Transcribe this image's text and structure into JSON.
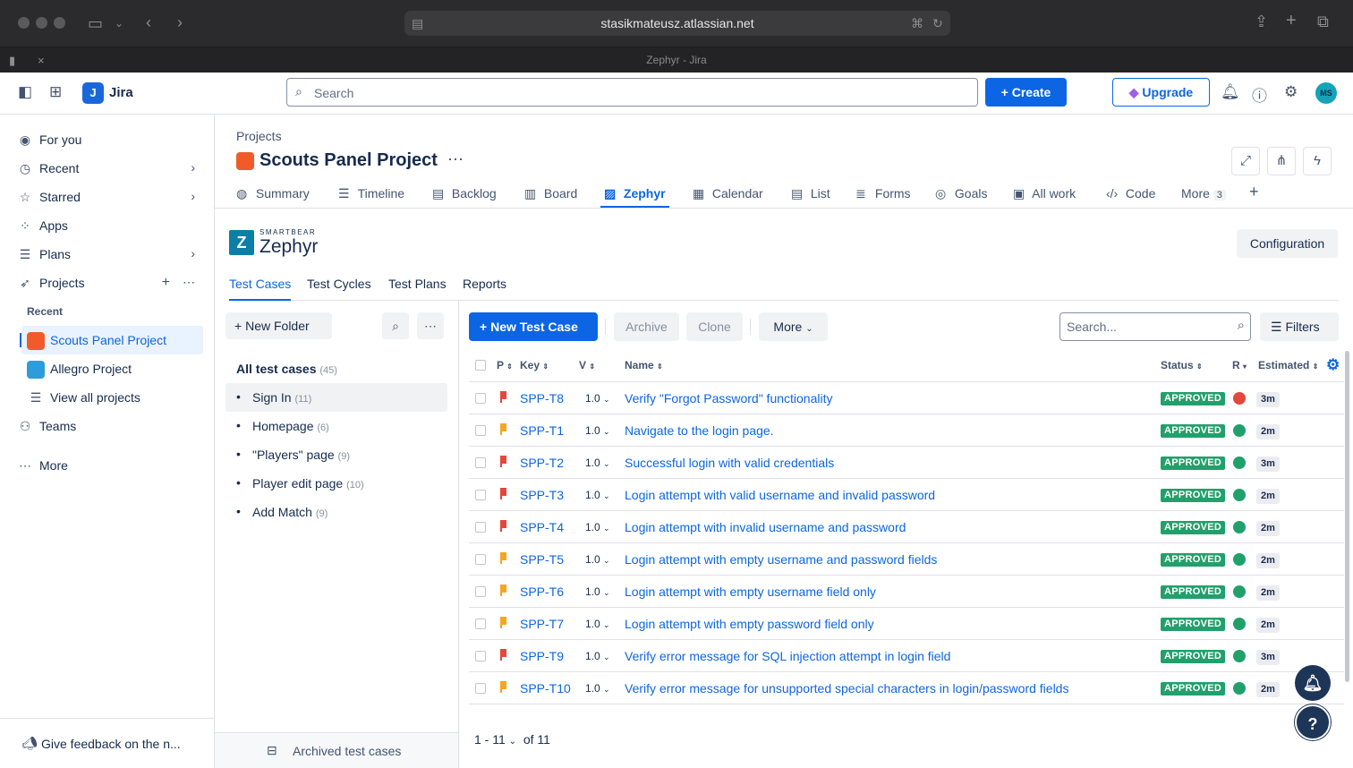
{
  "browser": {
    "url": "stasikmateusz.atlassian.net",
    "tab_title": "Zephyr - Jira"
  },
  "topnav": {
    "app_name": "Jira",
    "search_placeholder": "Search",
    "create_label": "Create",
    "upgrade_label": "Upgrade",
    "avatar_initials": "MS"
  },
  "sidebar": {
    "items": [
      {
        "label": "For you",
        "icon": "user-circle-icon"
      },
      {
        "label": "Recent",
        "icon": "clock-icon"
      },
      {
        "label": "Starred",
        "icon": "star-icon"
      },
      {
        "label": "Apps",
        "icon": "apps-icon"
      },
      {
        "label": "Plans",
        "icon": "plans-icon"
      },
      {
        "label": "Projects",
        "icon": "rocket-icon"
      }
    ],
    "recent_label": "Recent",
    "recent_projects": [
      {
        "label": "Scouts Panel Project",
        "color": "#f15b2a"
      },
      {
        "label": "Allegro Project",
        "color": "#2d9cdb"
      }
    ],
    "view_all": "View all projects",
    "teams": "Teams",
    "more": "More",
    "feedback": "Give feedback on the n..."
  },
  "header": {
    "breadcrumb": "Projects",
    "project_title": "Scouts Panel Project",
    "tabs": [
      {
        "label": "Summary",
        "icon": "globe-icon"
      },
      {
        "label": "Timeline",
        "icon": "timeline-icon"
      },
      {
        "label": "Backlog",
        "icon": "backlog-icon"
      },
      {
        "label": "Board",
        "icon": "board-icon"
      },
      {
        "label": "Zephyr",
        "icon": "zephyr-icon"
      },
      {
        "label": "Calendar",
        "icon": "calendar-icon"
      },
      {
        "label": "List",
        "icon": "list-icon"
      },
      {
        "label": "Forms",
        "icon": "forms-icon"
      },
      {
        "label": "Goals",
        "icon": "goals-icon"
      },
      {
        "label": "All work",
        "icon": "all-work-icon"
      },
      {
        "label": "Code",
        "icon": "code-icon"
      }
    ],
    "more_label": "More",
    "more_count": "3"
  },
  "zephyr": {
    "brand": "SMARTBEAR",
    "name": "Zephyr",
    "config_label": "Configuration",
    "tabs": [
      "Test Cases",
      "Test Cycles",
      "Test Plans",
      "Reports"
    ]
  },
  "folders": {
    "new_folder_label": "New Folder",
    "all_label": "All test cases",
    "all_count": "(45)",
    "items": [
      {
        "label": "Sign In",
        "count": "(11)"
      },
      {
        "label": "Homepage",
        "count": "(6)"
      },
      {
        "label": "\"Players\" page",
        "count": "(9)"
      },
      {
        "label": "Player edit page",
        "count": "(10)"
      },
      {
        "label": "Add Match",
        "count": "(9)"
      }
    ],
    "archived_label": "Archived test cases"
  },
  "toolbar": {
    "new_test_case": "New Test Case",
    "archive": "Archive",
    "clone": "Clone",
    "more": "More",
    "search_placeholder": "Search...",
    "filters": "Filters"
  },
  "table": {
    "headers": {
      "p": "P",
      "key": "Key",
      "v": "V",
      "name": "Name",
      "status": "Status",
      "r": "R",
      "estimated": "Estimated"
    },
    "rows": [
      {
        "priority": "high",
        "key": "SPP-T8",
        "version": "1.0",
        "name": "Verify \"Forgot Password\" functionality",
        "status": "APPROVED",
        "result": "#e2483d",
        "estimated": "3m"
      },
      {
        "priority": "normal",
        "key": "SPP-T1",
        "version": "1.0",
        "name": "Navigate to the login page.",
        "status": "APPROVED",
        "result": "#22a06b",
        "estimated": "2m"
      },
      {
        "priority": "high",
        "key": "SPP-T2",
        "version": "1.0",
        "name": "Successful login with valid credentials",
        "status": "APPROVED",
        "result": "#22a06b",
        "estimated": "3m"
      },
      {
        "priority": "high",
        "key": "SPP-T3",
        "version": "1.0",
        "name": "Login attempt with valid username and invalid password",
        "status": "APPROVED",
        "result": "#22a06b",
        "estimated": "2m"
      },
      {
        "priority": "high",
        "key": "SPP-T4",
        "version": "1.0",
        "name": "Login attempt with invalid username and password",
        "status": "APPROVED",
        "result": "#22a06b",
        "estimated": "2m"
      },
      {
        "priority": "normal",
        "key": "SPP-T5",
        "version": "1.0",
        "name": "Login attempt with empty username and password fields",
        "status": "APPROVED",
        "result": "#22a06b",
        "estimated": "2m"
      },
      {
        "priority": "normal",
        "key": "SPP-T6",
        "version": "1.0",
        "name": "Login attempt with empty username field only",
        "status": "APPROVED",
        "result": "#22a06b",
        "estimated": "2m"
      },
      {
        "priority": "normal",
        "key": "SPP-T7",
        "version": "1.0",
        "name": "Login attempt with empty password field only",
        "status": "APPROVED",
        "result": "#22a06b",
        "estimated": "2m"
      },
      {
        "priority": "high",
        "key": "SPP-T9",
        "version": "1.0",
        "name": "Verify error message for SQL injection attempt in login field",
        "status": "APPROVED",
        "result": "#22a06b",
        "estimated": "3m"
      },
      {
        "priority": "normal",
        "key": "SPP-T10",
        "version": "1.0",
        "name": "Verify error message for unsupported special characters in login/password fields",
        "status": "APPROVED",
        "result": "#22a06b",
        "estimated": "2m"
      }
    ],
    "pager_range": "1 - 11",
    "pager_total": "of 11"
  },
  "colors": {
    "accent": "#0c66e4",
    "high_priority": "#e2483d",
    "normal_priority": "#f5a623",
    "approved": "#22a06b"
  }
}
